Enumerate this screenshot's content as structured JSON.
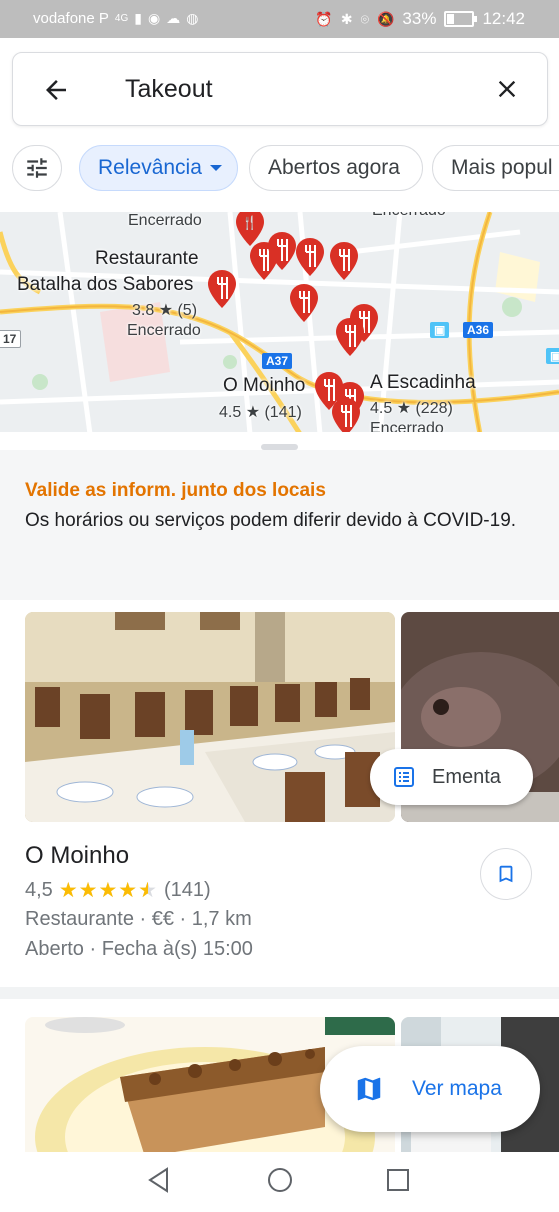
{
  "status_bar": {
    "carrier": "vodafone P",
    "network": "4G",
    "battery_percent": "33%",
    "battery_level": 0.33,
    "time": "12:42",
    "icons": [
      "eye-icon",
      "cloud-icon",
      "app-icon",
      "alarm-icon",
      "bluetooth-icon",
      "location-icon",
      "mute-icon"
    ]
  },
  "search": {
    "query": "Takeout",
    "back_icon": "arrow-back-icon",
    "clear_icon": "close-icon"
  },
  "chips": {
    "filter_icon": "tune-icon",
    "relevance": "Relevância",
    "open_now": "Abertos agora",
    "popular": "Mais popul"
  },
  "map": {
    "labels": {
      "closed_top_left": "Encerrado",
      "closed_top_right": "Encerrado",
      "restaurant_line1": "Restaurante",
      "restaurant_line2": "Batalha dos Sabores",
      "restaurant_rating": "3.8 ★ (5)",
      "restaurant_status": "Encerrado",
      "moinho_name": "O Moinho",
      "moinho_rating": "4.5 ★ (141)",
      "escadinha_name": "A Escadinha",
      "escadinha_rating": "4.5 ★ (228)",
      "escadinha_status": "Encerrado"
    },
    "road_signs": {
      "a37": "A37",
      "a36": "A36",
      "edge_17": "17"
    }
  },
  "notice": {
    "title": "Valide as inform. junto dos locais",
    "body": "Os horários ou serviços podem diferir devido à COVID-19."
  },
  "result": {
    "name": "O Moinho",
    "rating": "4,5",
    "rating_value": 4.5,
    "reviews": "(141)",
    "category_line": "Restaurante · €€ · 1,7 km",
    "hours_line": "Aberto · Fecha à(s) 15:00",
    "menu_button": "Ementa",
    "save_icon": "bookmark-icon"
  },
  "map_button": {
    "label": "Ver mapa",
    "icon": "map-icon"
  },
  "colors": {
    "accent": "#1a73e8",
    "warning": "#e37400",
    "star": "#fbbc04",
    "pin": "#d93025"
  }
}
